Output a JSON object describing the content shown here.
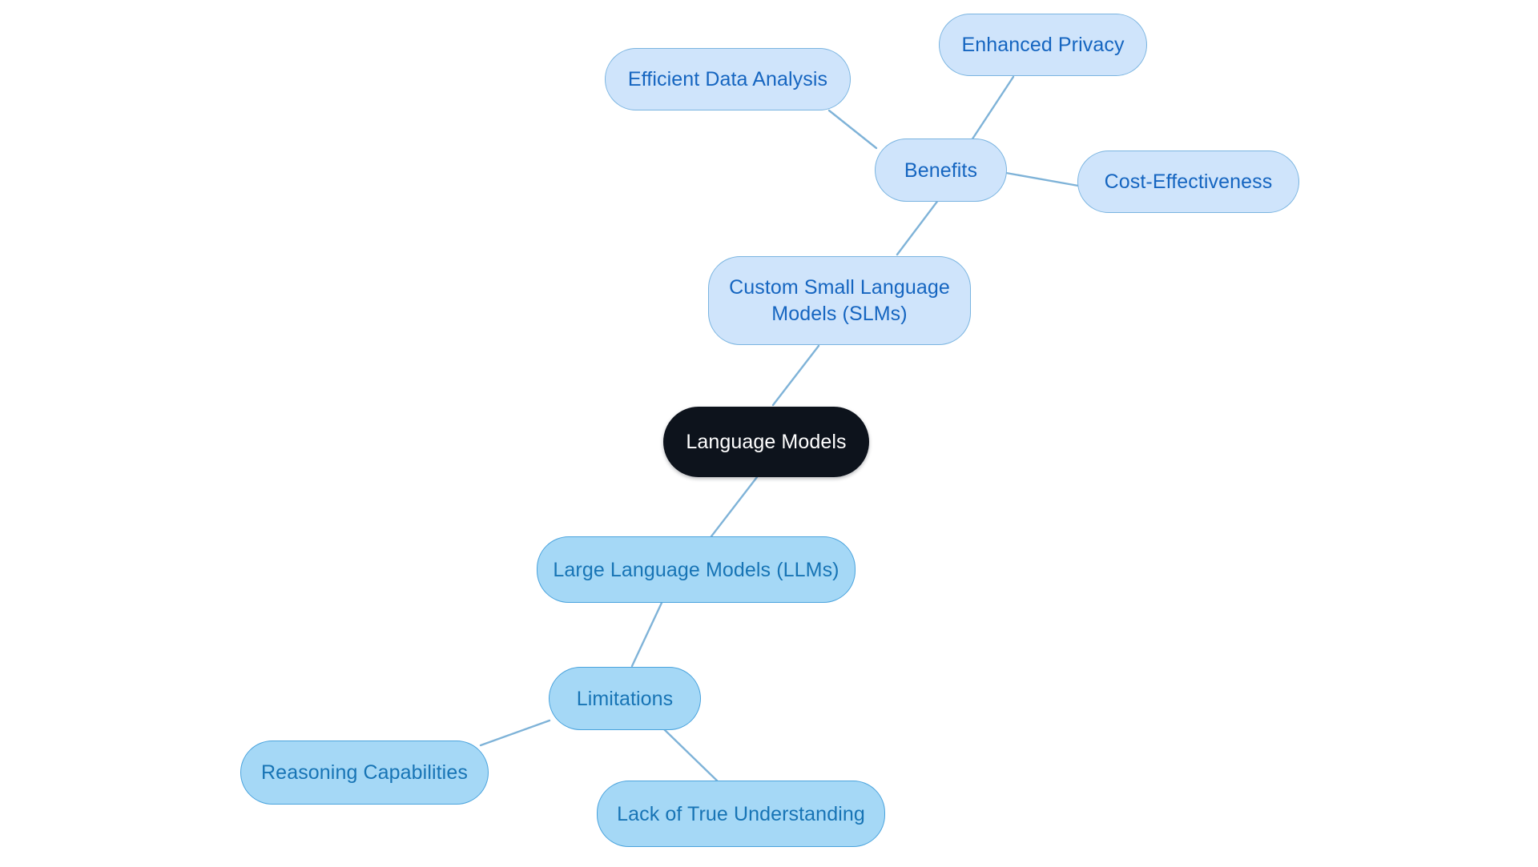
{
  "diagram": {
    "type": "mind-map",
    "title": "Language Models",
    "background_color": "#ffffff",
    "edge_color": "#7fb3d8",
    "palette": {
      "root_fill": "#0d131c",
      "root_text": "#ffffff",
      "light_blue_fill": "#cfe4fb",
      "light_blue_border": "#7ab4e0",
      "light_blue_text": "#1565c0",
      "mid_blue_fill": "#a5d8f6",
      "mid_blue_border": "#4aa3dd",
      "mid_blue_text": "#1774b5"
    }
  },
  "nodes": {
    "root": {
      "label": "Language Models"
    },
    "slm": {
      "label": "Custom Small Language\nModels (SLMs)"
    },
    "benefits": {
      "label": "Benefits"
    },
    "efficient_data_analysis": {
      "label": "Efficient Data Analysis"
    },
    "enhanced_privacy": {
      "label": "Enhanced Privacy"
    },
    "cost_effectiveness": {
      "label": "Cost-Effectiveness"
    },
    "llm": {
      "label": "Large Language Models (LLMs)"
    },
    "limitations": {
      "label": "Limitations"
    },
    "reasoning_capabilities": {
      "label": "Reasoning Capabilities"
    },
    "lack_of_true_understanding": {
      "label": "Lack of True Understanding"
    }
  },
  "chart_data": {
    "type": "diagram",
    "subtype": "mind-map",
    "title": "Language Models",
    "root": "Language Models",
    "nodes": [
      {
        "id": "root",
        "label": "Language Models",
        "level": 0,
        "style": "dark"
      },
      {
        "id": "slm",
        "label": "Custom Small Language Models (SLMs)",
        "level": 1,
        "style": "light-blue"
      },
      {
        "id": "benefits",
        "label": "Benefits",
        "level": 2,
        "style": "light-blue"
      },
      {
        "id": "efficient_data_analysis",
        "label": "Efficient Data Analysis",
        "level": 3,
        "style": "light-blue"
      },
      {
        "id": "enhanced_privacy",
        "label": "Enhanced Privacy",
        "level": 3,
        "style": "light-blue"
      },
      {
        "id": "cost_effectiveness",
        "label": "Cost-Effectiveness",
        "level": 3,
        "style": "light-blue"
      },
      {
        "id": "llm",
        "label": "Large Language Models (LLMs)",
        "level": 1,
        "style": "mid-blue"
      },
      {
        "id": "limitations",
        "label": "Limitations",
        "level": 2,
        "style": "mid-blue"
      },
      {
        "id": "reasoning_capabilities",
        "label": "Reasoning Capabilities",
        "level": 3,
        "style": "mid-blue"
      },
      {
        "id": "lack_of_true_understanding",
        "label": "Lack of True Understanding",
        "level": 3,
        "style": "mid-blue"
      }
    ],
    "edges": [
      {
        "from": "root",
        "to": "slm"
      },
      {
        "from": "slm",
        "to": "benefits"
      },
      {
        "from": "benefits",
        "to": "efficient_data_analysis"
      },
      {
        "from": "benefits",
        "to": "enhanced_privacy"
      },
      {
        "from": "benefits",
        "to": "cost_effectiveness"
      },
      {
        "from": "root",
        "to": "llm"
      },
      {
        "from": "llm",
        "to": "limitations"
      },
      {
        "from": "limitations",
        "to": "reasoning_capabilities"
      },
      {
        "from": "limitations",
        "to": "lack_of_true_understanding"
      }
    ]
  }
}
